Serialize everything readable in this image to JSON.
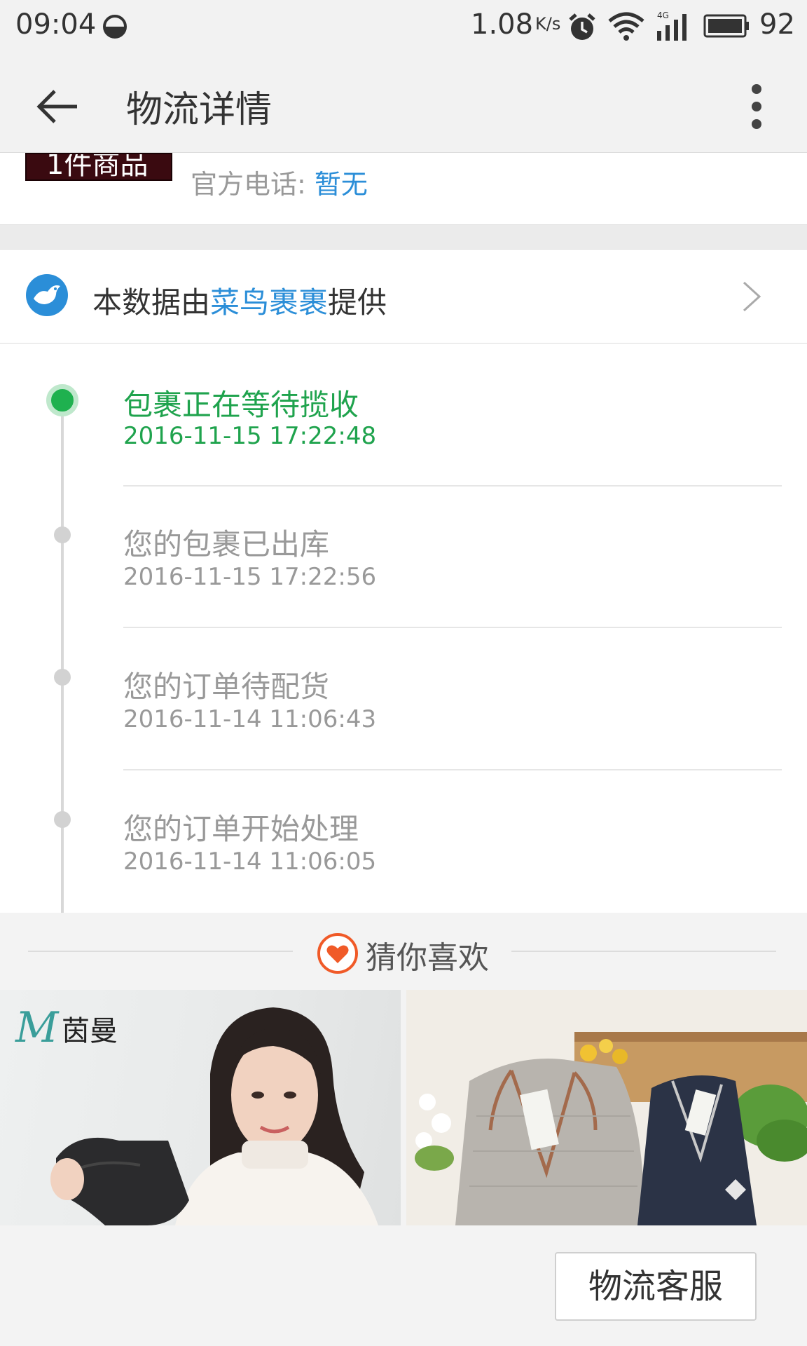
{
  "status_bar": {
    "time": "09:04",
    "net_speed": "1.08",
    "net_speed_unit": "K/s",
    "network_type": "4G",
    "battery": "92"
  },
  "app_bar": {
    "title": "物流详情",
    "back_icon": "arrow-left-icon",
    "more_icon": "more-vertical-icon"
  },
  "order": {
    "item_count_label": "1件商品",
    "phone_label": "官方电话: ",
    "phone_value": "暂无"
  },
  "provider": {
    "prefix": "本数据由",
    "name": "菜鸟裹裹",
    "suffix": "提供"
  },
  "timeline": [
    {
      "status": "包裹正在等待揽收",
      "time": "2016-11-15 17:22:48",
      "current": true
    },
    {
      "status": "您的包裹已出库",
      "time": "2016-11-15 17:22:56",
      "current": false
    },
    {
      "status": "您的订单待配货",
      "time": "2016-11-14 11:06:43",
      "current": false
    },
    {
      "status": "您的订单开始处理",
      "time": "2016-11-14 11:06:05",
      "current": false
    }
  ],
  "recommend": {
    "title": "猜你喜欢",
    "products": [
      {
        "brand_logo": "茵曼",
        "kind": "women boots with model"
      },
      {
        "kind": "quilted pajama sets"
      }
    ]
  },
  "service_button": "物流客服",
  "colors": {
    "accent_green": "#1fa34d",
    "link_blue": "#2b8ed8",
    "heart_orange": "#f05a28"
  }
}
